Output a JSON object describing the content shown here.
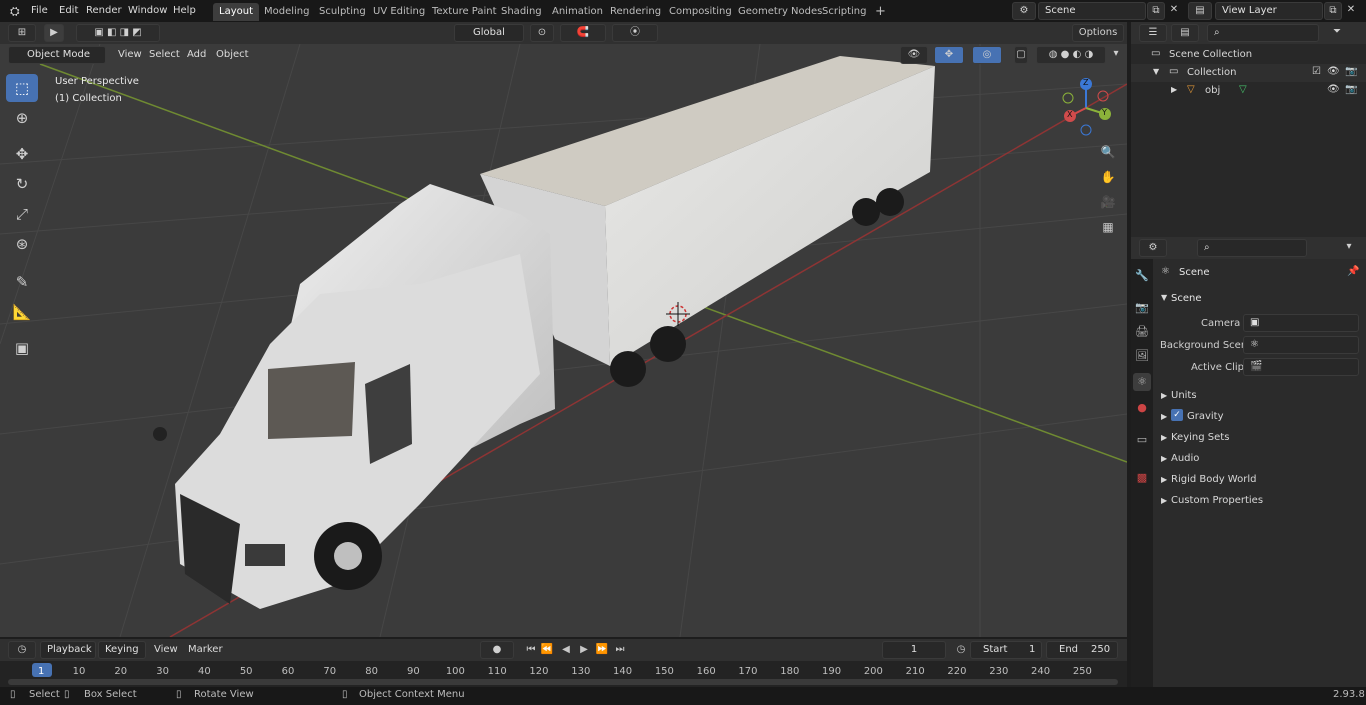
{
  "menu": {
    "file": "File",
    "edit": "Edit",
    "render": "Render",
    "window": "Window",
    "help": "Help"
  },
  "workspaces": [
    "Layout",
    "Modeling",
    "Sculpting",
    "UV Editing",
    "Texture Paint",
    "Shading",
    "Animation",
    "Rendering",
    "Compositing",
    "Geometry Nodes",
    "Scripting"
  ],
  "scene_field": "Scene",
  "view_layer_field": "View Layer",
  "viewport_header": {
    "mode": "Object Mode",
    "view": "View",
    "select": "Select",
    "add": "Add",
    "object": "Object",
    "orientation": "Global",
    "options": "Options"
  },
  "viewport": {
    "perspective": "User Perspective",
    "collection": "(1) Collection"
  },
  "gizmo": {
    "x": "X",
    "y": "Y",
    "z": "Z"
  },
  "outliner": {
    "scene_collection": "Scene Collection",
    "collection": "Collection",
    "object": "obj"
  },
  "properties": {
    "scene_title": "Scene",
    "panel": "Scene",
    "camera_label": "Camera",
    "background_label": "Background Scene",
    "clip_label": "Active Clip",
    "sections": [
      "Units",
      "Gravity",
      "Keying Sets",
      "Audio",
      "Rigid Body World",
      "Custom Properties"
    ]
  },
  "timeline": {
    "playback": "Playback",
    "keying": "Keying",
    "view": "View",
    "marker": "Marker",
    "current_frame": "1",
    "start_label": "Start",
    "start": "1",
    "end_label": "End",
    "end": "250"
  },
  "ruler": [
    "1",
    "10",
    "20",
    "30",
    "40",
    "50",
    "60",
    "70",
    "80",
    "90",
    "100",
    "110",
    "120",
    "130",
    "140",
    "150",
    "160",
    "170",
    "180",
    "190",
    "200",
    "210",
    "220",
    "230",
    "240",
    "250"
  ],
  "status": {
    "select": "Select",
    "box_select": "Box Select",
    "rotate": "Rotate View",
    "context": "Object Context Menu",
    "version": "2.93.8"
  },
  "colors": {
    "accent": "#4772b3",
    "x_axis": "#a33a3a",
    "y_axis": "#7a9a2f"
  }
}
